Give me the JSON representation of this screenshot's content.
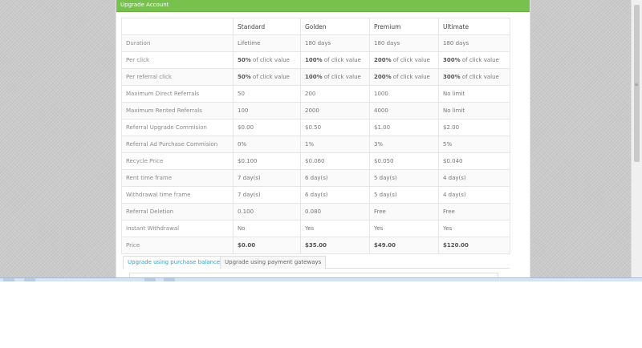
{
  "panel": {
    "title": "Upgrade Account"
  },
  "table": {
    "headers": [
      "",
      "Standard",
      "Golden",
      "Premium",
      "Ultimate"
    ],
    "rows": [
      {
        "label": "Duration",
        "cells": [
          {
            "v": "Lifetime"
          },
          {
            "v": "180 days"
          },
          {
            "v": "180 days"
          },
          {
            "v": "180 days"
          }
        ]
      },
      {
        "label": "Per click",
        "cells": [
          {
            "b": "50%",
            "v": " of click value"
          },
          {
            "b": "100%",
            "v": " of click value"
          },
          {
            "b": "200%",
            "v": " of click value"
          },
          {
            "b": "300%",
            "v": " of click value"
          }
        ]
      },
      {
        "label": "Per referral click",
        "cells": [
          {
            "b": "50%",
            "v": " of click value"
          },
          {
            "b": "100%",
            "v": " of click value"
          },
          {
            "b": "200%",
            "v": " of click value"
          },
          {
            "b": "300%",
            "v": " of click value"
          }
        ]
      },
      {
        "label": "Maximum Direct Referrals",
        "cells": [
          {
            "v": "50"
          },
          {
            "v": "200"
          },
          {
            "v": "1000"
          },
          {
            "v": "No limit"
          }
        ]
      },
      {
        "label": "Maximum Rented Referrals",
        "cells": [
          {
            "v": "100"
          },
          {
            "v": "2000"
          },
          {
            "v": "4000"
          },
          {
            "v": "No limit"
          }
        ]
      },
      {
        "label": "Referral Upgrade Commision",
        "cells": [
          {
            "v": "$0.00"
          },
          {
            "v": "$0.50"
          },
          {
            "v": "$1.00"
          },
          {
            "v": "$2.00"
          }
        ]
      },
      {
        "label": "Referral Ad Purchase Commision",
        "cells": [
          {
            "v": "0%"
          },
          {
            "v": "1%"
          },
          {
            "v": "3%"
          },
          {
            "v": "5%"
          }
        ]
      },
      {
        "label": "Recycle Price",
        "cells": [
          {
            "v": "$0.100"
          },
          {
            "v": "$0.060"
          },
          {
            "v": "$0.050"
          },
          {
            "v": "$0.040"
          }
        ]
      },
      {
        "label": "Rent time frame",
        "cells": [
          {
            "v": "7 day(s)"
          },
          {
            "v": "6 day(s)"
          },
          {
            "v": "5 day(s)"
          },
          {
            "v": "4 day(s)"
          }
        ]
      },
      {
        "label": "Withdrawal time frame",
        "cells": [
          {
            "v": "7 day(s)"
          },
          {
            "v": "6 day(s)"
          },
          {
            "v": "5 day(s)"
          },
          {
            "v": "4 day(s)"
          }
        ]
      },
      {
        "label": "Referral Deletion",
        "cells": [
          {
            "v": "0.100"
          },
          {
            "v": "0.080"
          },
          {
            "v": "Free"
          },
          {
            "v": "Free"
          }
        ]
      },
      {
        "label": "Instant Withdrawal",
        "cells": [
          {
            "v": "No"
          },
          {
            "v": "Yes"
          },
          {
            "v": "Yes"
          },
          {
            "v": "Yes"
          }
        ]
      },
      {
        "label": "Price",
        "cells": [
          {
            "b": "$0.00"
          },
          {
            "b": "$35.00"
          },
          {
            "b": "$49.00"
          },
          {
            "b": "$120.00"
          }
        ]
      }
    ]
  },
  "tabs": [
    {
      "label": "Upgrade using purchase balance",
      "active": true
    },
    {
      "label": "Upgrade using payment gateways",
      "active": false
    }
  ],
  "colors": {
    "header_green": "#78c14f",
    "tab_active": "#3d9ecb"
  }
}
